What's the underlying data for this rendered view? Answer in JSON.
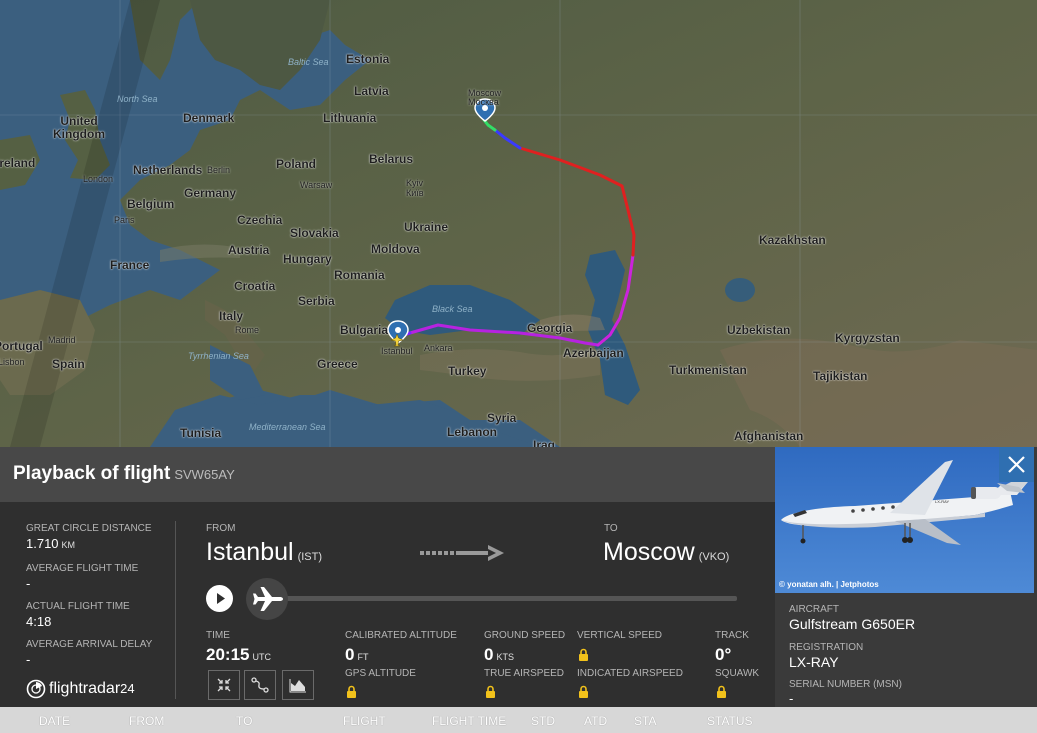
{
  "map": {
    "countries": [
      "Estonia",
      "Latvia",
      "Lithuania",
      "United Kingdom",
      "Ireland",
      "Denmark",
      "Netherlands",
      "Poland",
      "Belarus",
      "Germany",
      "Belgium",
      "France",
      "Czechia",
      "Slovakia",
      "Ukraine",
      "Austria",
      "Hungary",
      "Moldova",
      "Romania",
      "Croatia",
      "Serbia",
      "Italy",
      "Bulgaria",
      "Portugal",
      "Spain",
      "Greece",
      "Turkey",
      "Georgia",
      "Azerbaijan",
      "Kazakhstan",
      "Uzbekistan",
      "Kyrgyzstan",
      "Turkmenistan",
      "Tajikistan",
      "Syria",
      "Lebanon",
      "Iraq",
      "Afghanistan",
      "Tunisia"
    ],
    "cities": [
      "Moscow\nМосква",
      "Berlin",
      "London",
      "Warsaw",
      "Kyiv\nКиїв",
      "Paris",
      "Rome",
      "Istanbul",
      "Ankara",
      "Madrid",
      "Lisbon"
    ],
    "seas": [
      "Baltic Sea",
      "North Sea",
      "Black Sea",
      "Tyrrhenian Sea",
      "Mediterranean Sea"
    ]
  },
  "panel": {
    "title": "Playback of flight",
    "callsign": "SVW65AY",
    "great_circle_label": "GREAT CIRCLE DISTANCE",
    "great_circle_value": "1.710",
    "great_circle_unit": "KM",
    "avg_flight_time_label": "AVERAGE FLIGHT TIME",
    "avg_flight_time_value": "-",
    "actual_flight_time_label": "ACTUAL FLIGHT TIME",
    "actual_flight_time_value": "4:18",
    "avg_arrival_delay_label": "AVERAGE ARRIVAL DELAY",
    "avg_arrival_delay_value": "-",
    "from_label": "FROM",
    "from_city": "Istanbul",
    "from_code": "(IST)",
    "to_label": "TO",
    "to_city": "Moscow",
    "to_code": "(VKO)",
    "playback_progress": 0,
    "time_label": "TIME",
    "time_value": "20:15",
    "time_unit": "UTC",
    "cal_alt_label": "CALIBRATED ALTITUDE",
    "cal_alt_value": "0",
    "cal_alt_unit": "FT",
    "gps_alt_label": "GPS ALTITUDE",
    "ground_speed_label": "GROUND SPEED",
    "ground_speed_value": "0",
    "ground_speed_unit": "KTS",
    "true_airspeed_label": "TRUE AIRSPEED",
    "vertical_speed_label": "VERTICAL SPEED",
    "indicated_airspeed_label": "INDICATED AIRSPEED",
    "track_label": "TRACK",
    "track_value": "0°",
    "squawk_label": "SQUAWK",
    "logo_text": "flightradar",
    "logo_num": "24"
  },
  "aircraft": {
    "photo_credit": "© yonatan alh. | Jetphotos",
    "aircraft_label": "AIRCRAFT",
    "aircraft_value": "Gulfstream G650ER",
    "registration_label": "REGISTRATION",
    "registration_value": "LX-RAY",
    "serial_label": "SERIAL NUMBER (MSN)",
    "serial_value": "-",
    "tail_marking": "LX-RAY"
  },
  "table_header": [
    "DATE",
    "FROM",
    "TO",
    "FLIGHT",
    "FLIGHT TIME",
    "STD",
    "ATD",
    "STA",
    "STATUS"
  ],
  "colors": {
    "track_low": "#7a22ff",
    "track_mid": "#cc22dd",
    "track_high": "#e02020",
    "close_bg": "#2f6fb1"
  }
}
